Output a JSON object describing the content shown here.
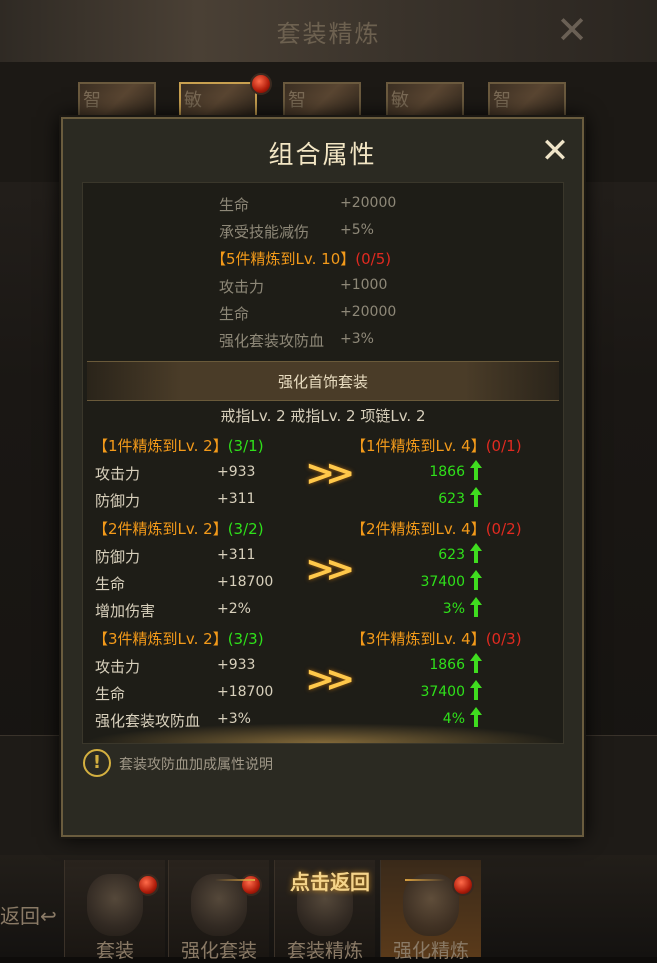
{
  "header": {
    "title": "套装精炼"
  },
  "slots": [
    "智",
    "敏",
    "智",
    "敏",
    "智"
  ],
  "dialog": {
    "title": "组合属性",
    "top_stats": [
      {
        "label": "生命",
        "value": "+20000"
      },
      {
        "label": "承受技能减伤",
        "value": "+5%"
      }
    ],
    "tier5": {
      "title": "【5件精炼到Lv. 10】",
      "progress": "(0/5)"
    },
    "tier5_stats": [
      {
        "label": "攻击力",
        "value": "+1000"
      },
      {
        "label": "生命",
        "value": "+20000"
      },
      {
        "label": "强化套装攻防血",
        "value": "+3%"
      }
    ],
    "section_title": "强化首饰套装",
    "equip_summary": "戒指Lv. 2 戒指Lv. 2 项链Lv. 2",
    "groups": [
      {
        "cur_title": "【1件精炼到Lv. 2】",
        "cur_progress": "(3/1)",
        "next_title": "【1件精炼到Lv. 4】",
        "next_progress": "(0/1)",
        "stats": [
          {
            "label": "攻击力",
            "cur": "+933",
            "next": "1866"
          },
          {
            "label": "防御力",
            "cur": "+311",
            "next": "623"
          }
        ]
      },
      {
        "cur_title": "【2件精炼到Lv. 2】",
        "cur_progress": "(3/2)",
        "next_title": "【2件精炼到Lv. 4】",
        "next_progress": "(0/2)",
        "stats": [
          {
            "label": "防御力",
            "cur": "+311",
            "next": "623"
          },
          {
            "label": "生命",
            "cur": "+18700",
            "next": "37400"
          },
          {
            "label": "增加伤害",
            "cur": "+2%",
            "next": "3%"
          }
        ]
      },
      {
        "cur_title": "【3件精炼到Lv. 2】",
        "cur_progress": "(3/3)",
        "next_title": "【3件精炼到Lv. 4】",
        "next_progress": "(0/3)",
        "stats": [
          {
            "label": "攻击力",
            "cur": "+933",
            "next": "1866"
          },
          {
            "label": "生命",
            "cur": "+18700",
            "next": "37400"
          },
          {
            "label": "强化套装攻防血",
            "cur": "+3%",
            "next": "4%"
          }
        ]
      }
    ],
    "info_text": "套装攻防血加成属性说明"
  },
  "bottom": {
    "return_label": "点击返回",
    "back_label": "返回",
    "tabs": [
      "套装",
      "强化套装",
      "套装精炼",
      "强化精炼"
    ]
  },
  "colors": {
    "orange": "#f39a1a",
    "red": "#e02a20",
    "green": "#2fe01a",
    "gold": "#ffc84a"
  }
}
